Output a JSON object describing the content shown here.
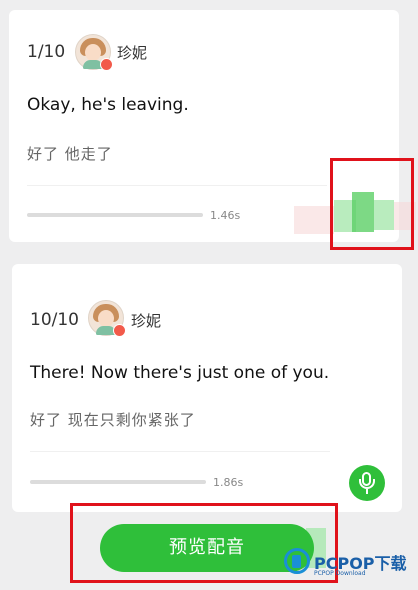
{
  "items": [
    {
      "counter": "1/10",
      "speaker": "珍妮",
      "sentence": "Okay, he's leaving.",
      "translation": "好了  他走了",
      "duration": "1.46s"
    },
    {
      "counter": "10/10",
      "speaker": "珍妮",
      "sentence": "There! Now there's just one of you.",
      "translation": "好了  现在只剩你紧张了",
      "duration": "1.86s"
    }
  ],
  "preview_button": "预览配音",
  "watermark": {
    "text": "PCPOP下载",
    "subtext": "PCPOP Download"
  },
  "colors": {
    "accent": "#2fbf3a",
    "highlight": "#e0121b",
    "background": "#eeeeef"
  }
}
